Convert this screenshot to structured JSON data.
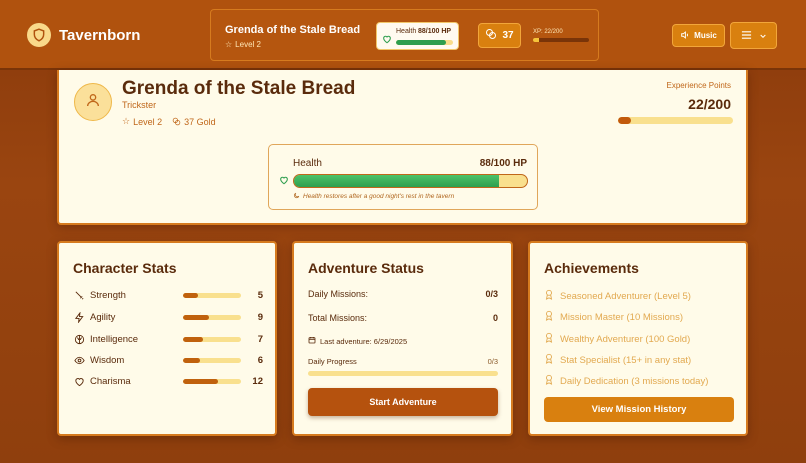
{
  "app": {
    "name": "Tavernborn",
    "logo_icon": "shield-icon"
  },
  "header": {
    "character_name": "Grenda of the Stale Bread",
    "level_label": "Level 2",
    "health_label": "Health",
    "health_value": "88/100 HP",
    "health_fraction": 0.88,
    "gold": "37",
    "xp_label": "XP: 22/200",
    "xp_fraction": 0.11,
    "music_label": "Music"
  },
  "profile": {
    "name": "Grenda of the Stale Bread",
    "class": "Trickster",
    "level": "Level 2",
    "gold": "37 Gold",
    "xp_title": "Experience Points",
    "xp_value": "22/200",
    "xp_fraction": 0.11,
    "health_label": "Health",
    "health_value": "88/100 HP",
    "health_fraction": 0.88,
    "health_note": "Health restores after a good night's rest in the tavern"
  },
  "stats": {
    "title": "Character Stats",
    "items": [
      {
        "name": "Strength",
        "value": "5",
        "fraction": 0.25,
        "icon": "sword-icon"
      },
      {
        "name": "Agility",
        "value": "9",
        "fraction": 0.45,
        "icon": "lightning-icon"
      },
      {
        "name": "Intelligence",
        "value": "7",
        "fraction": 0.35,
        "icon": "brain-icon"
      },
      {
        "name": "Wisdom",
        "value": "6",
        "fraction": 0.3,
        "icon": "eye-icon"
      },
      {
        "name": "Charisma",
        "value": "12",
        "fraction": 0.6,
        "icon": "heart-icon"
      }
    ]
  },
  "adventure": {
    "title": "Adventure Status",
    "daily_label": "Daily Missions:",
    "daily_value": "0/3",
    "total_label": "Total Missions:",
    "total_value": "0",
    "last_adventure": "Last adventure: 6/29/2025",
    "progress_label": "Daily Progress",
    "progress_value": "0/3",
    "progress_fraction": 0,
    "start_button": "Start Adventure"
  },
  "achievements": {
    "title": "Achievements",
    "items": [
      "Seasoned Adventurer (Level 5)",
      "Mission Master (10 Missions)",
      "Wealthy Adventurer (100 Gold)",
      "Stat Specialist (15+ in any stat)",
      "Daily Dedication (3 missions today)"
    ],
    "history_button": "View Mission History"
  },
  "colors": {
    "accent": "#d9800f",
    "primary_dark": "#b5520e",
    "health_green": "#2e9e4e",
    "card_bg": "#fffbe9"
  }
}
